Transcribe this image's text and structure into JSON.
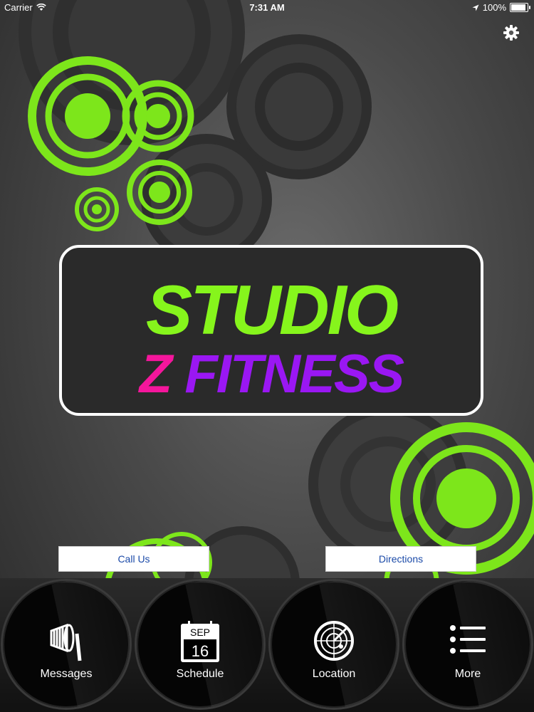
{
  "status_bar": {
    "carrier": "Carrier",
    "time": "7:31 AM",
    "battery": "100%",
    "battery_level": 1.0
  },
  "header": {
    "settings_icon": "gear-icon"
  },
  "logo": {
    "line1": "STUDIO",
    "line2_z": "Z",
    "line2_fitness": "FITNESS",
    "colors": {
      "green": "#86f51c",
      "pink": "#f5169c",
      "purple": "#9a17f3"
    }
  },
  "actions": {
    "call": "Call Us",
    "directions": "Directions"
  },
  "tabs": [
    {
      "label": "Messages",
      "icon": "megaphone-icon"
    },
    {
      "label": "Schedule",
      "icon": "calendar-icon",
      "month": "SEP",
      "day": "16"
    },
    {
      "label": "Location",
      "icon": "radar-icon"
    },
    {
      "label": "More",
      "icon": "list-icon"
    }
  ]
}
